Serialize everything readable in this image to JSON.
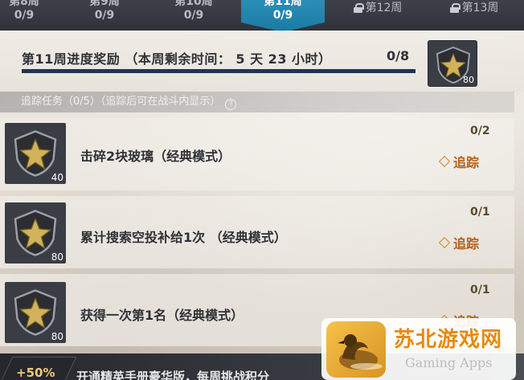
{
  "tabs": [
    {
      "line1": "第8周",
      "line2": "0/9",
      "state": "normal"
    },
    {
      "line1": "第9周",
      "line2": "0/9",
      "state": "normal"
    },
    {
      "line1": "第10周",
      "line2": "0/9",
      "state": "normal"
    },
    {
      "line1": "第11周",
      "line2": "0/9",
      "state": "active"
    },
    {
      "line1": "第12周",
      "state": "locked"
    },
    {
      "line1": "第13周",
      "state": "locked"
    }
  ],
  "week": {
    "title": "第11周进度奖励 （本周剩余时间： 5 天 23 小时）",
    "progress": "0/8",
    "progress_fraction": 0,
    "reward_count": "80"
  },
  "tracking": {
    "label": "追踪任务（0/5）（追踪后可在战斗内显示）",
    "help": "?"
  },
  "tasks": [
    {
      "name": "击碎2块玻璃（经典模式）",
      "progress": "0/2",
      "track_label": "追踪",
      "reward": "40"
    },
    {
      "name": "累计搜索空投补给1次 （经典模式）",
      "progress": "0/1",
      "track_label": "追踪",
      "reward": "80"
    },
    {
      "name": "获得一次第1名（经典模式）",
      "progress": "0/1",
      "track_label": "追踪",
      "reward": "80"
    }
  ],
  "promo": {
    "badge": "+50%",
    "text": "开通精英手册豪华版，每周挑战积分"
  },
  "watermark": {
    "title": "苏北游戏网",
    "subtitle": "Gaming Apps"
  },
  "colors": {
    "tab_active": "#2a8fb7",
    "tab_bg": "#2f3239",
    "progress_fill": "#f0a43a",
    "progress_track": "#1f3550",
    "track_orange": "#b4621c",
    "watermark_orange": "#e88a12"
  }
}
